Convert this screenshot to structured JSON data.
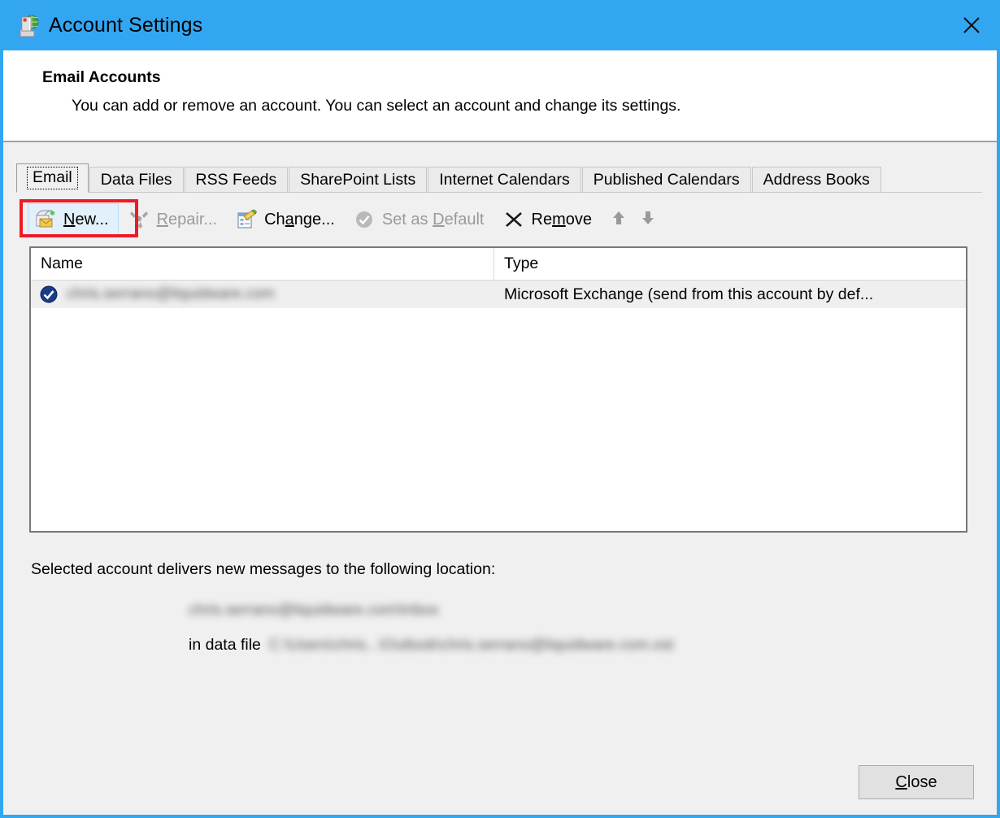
{
  "window": {
    "title": "Account Settings",
    "icon": "account-settings-icon",
    "close_icon": "close-icon",
    "accent_color": "#33a6f2",
    "background_color": "#f0f0f0"
  },
  "header": {
    "title": "Email Accounts",
    "description": "You can add or remove an account. You can select an account and change its settings."
  },
  "tabs": [
    {
      "label": "Email",
      "selected": true
    },
    {
      "label": "Data Files",
      "selected": false
    },
    {
      "label": "RSS Feeds",
      "selected": false
    },
    {
      "label": "SharePoint Lists",
      "selected": false
    },
    {
      "label": "Internet Calendars",
      "selected": false
    },
    {
      "label": "Published Calendars",
      "selected": false
    },
    {
      "label": "Address Books",
      "selected": false
    }
  ],
  "toolbar": {
    "new": {
      "label": "New...",
      "accel": "N",
      "icon": "new-mail-icon",
      "disabled": false,
      "highlighted": true
    },
    "repair": {
      "label": "Repair...",
      "accel": "R",
      "icon": "repair-tools-icon",
      "disabled": true
    },
    "change": {
      "label": "Change...",
      "accel": "a",
      "icon": "change-form-icon",
      "disabled": false
    },
    "set_default": {
      "label": "Set as Default",
      "accel": "D",
      "icon": "check-circle-icon",
      "disabled": true
    },
    "remove": {
      "label": "Remove",
      "accel": "m",
      "icon": "remove-x-icon",
      "disabled": false
    },
    "move_up": {
      "icon": "arrow-up-icon",
      "disabled": true
    },
    "move_down": {
      "icon": "arrow-down-icon",
      "disabled": true
    },
    "annotation_color": "#ee1b24"
  },
  "account_list": {
    "columns": [
      "Name",
      "Type"
    ],
    "rows": [
      {
        "icon": "default-account-check-icon",
        "name": "chris.serrano@liquidware.com",
        "name_redacted": true,
        "type": "Microsoft Exchange (send from this account by def...",
        "selected": true
      }
    ]
  },
  "delivery": {
    "label": "Selected account delivers new messages to the following location:",
    "location": "chris.serrano@liquidware.com\\Inbox",
    "location_redacted": true,
    "data_file_label": "in data file",
    "data_file_path": "C:\\Users\\chris...\\Outlook\\chris.serrano@liquidware.com.ost",
    "data_file_redacted": true
  },
  "footer": {
    "close_button": {
      "label": "Close",
      "accel": "C"
    }
  }
}
